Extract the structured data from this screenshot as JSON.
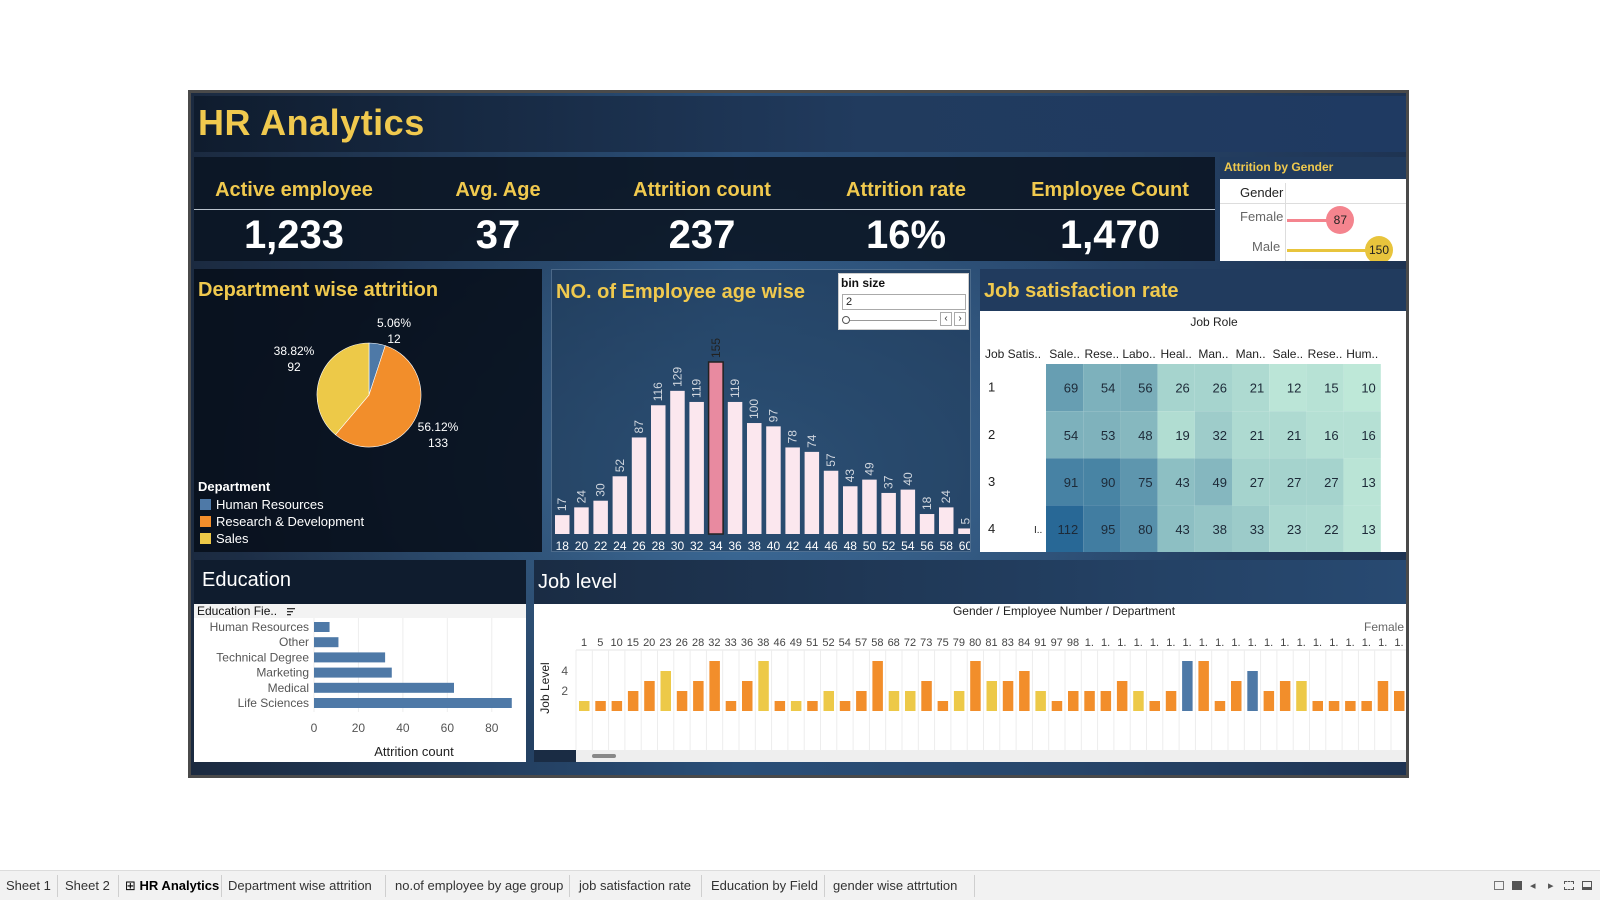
{
  "title": "HR Analytics",
  "kpis": [
    {
      "label": "Active employee",
      "value": "1,233"
    },
    {
      "label": "Avg. Age",
      "value": "37"
    },
    {
      "label": "Attrition count",
      "value": "237"
    },
    {
      "label": "Attrition rate",
      "value": "16%"
    },
    {
      "label": "Employee Count",
      "value": "1,470"
    }
  ],
  "gender_panel": {
    "title": "Attrition by Gender",
    "column": "Gender",
    "rows": [
      {
        "label": "Female",
        "value": 87,
        "color": "#f4848e"
      },
      {
        "label": "Male",
        "value": 150,
        "color": "#e8c43c"
      }
    ]
  },
  "department_panel": {
    "title": "Department wise attrition",
    "legend_title": "Department",
    "slices": [
      {
        "name": "Human Resources",
        "value": 12,
        "pct": "5.06%",
        "color": "#4e79a7"
      },
      {
        "name": "Research & Development",
        "value": 133,
        "pct": "56.12%",
        "color": "#f28e2b"
      },
      {
        "name": "Sales",
        "value": 92,
        "pct": "38.82%",
        "color": "#edc948"
      }
    ]
  },
  "age_panel": {
    "title": "NO. of Employee age wise",
    "bin_label": "bin size",
    "bin_value": "2",
    "highlight_index": 8,
    "bar_color": "#fbe7ee",
    "highlight_color": "#e88aa0"
  },
  "job_panel": {
    "title": "Job satisfaction rate",
    "column_header": "Job Role",
    "row_header": "Job Satis..",
    "truncated_marker": "I..",
    "columns": [
      "Sale..",
      "Rese..",
      "Labo..",
      "Heal..",
      "Man..",
      "Man..",
      "Sale..",
      "Rese..",
      "Hum.."
    ],
    "rows": [
      {
        "label": "1",
        "values": [
          69,
          54,
          56,
          26,
          26,
          21,
          12,
          15,
          10
        ]
      },
      {
        "label": "2",
        "values": [
          54,
          53,
          48,
          19,
          32,
          21,
          21,
          16,
          16
        ]
      },
      {
        "label": "3",
        "values": [
          91,
          90,
          75,
          43,
          49,
          27,
          27,
          27,
          13
        ]
      },
      {
        "label": "4",
        "values": [
          112,
          95,
          80,
          43,
          38,
          33,
          23,
          22,
          13
        ]
      }
    ]
  },
  "education_panel": {
    "title": "Education",
    "field_header": "Education Fie..",
    "sort_icon": "sort-icon",
    "bar_color": "#4e79a7"
  },
  "level_panel": {
    "title": "Job level",
    "header": "Gender / Employee Number / Department",
    "female_label": "Female",
    "y_label": "Job Level",
    "y_ticks": [
      "4",
      "2"
    ],
    "x_labels": [
      "1",
      "5",
      "10",
      "15",
      "20",
      "23",
      "26",
      "28",
      "32",
      "33",
      "36",
      "38",
      "46",
      "49",
      "51",
      "52",
      "54",
      "57",
      "58",
      "68",
      "72",
      "73",
      "75",
      "79",
      "80",
      "81",
      "83",
      "84",
      "91",
      "97",
      "98",
      "1.",
      "1.",
      "1.",
      "1.",
      "1.",
      "1.",
      "1.",
      "1.",
      "1.",
      "1.",
      "1.",
      "1.",
      "1.",
      "1.",
      "1.",
      "1.",
      "1.",
      "1.",
      "1.",
      "1."
    ],
    "colors": {
      "hr": "#4e79a7",
      "rd": "#f28e2b",
      "sales": "#edc948"
    }
  },
  "chart_data": [
    {
      "type": "pie",
      "title": "Department wise attrition",
      "categories": [
        "Human Resources",
        "Research & Development",
        "Sales"
      ],
      "values": [
        12,
        133,
        92
      ],
      "legend": "bottom-left"
    },
    {
      "type": "bar",
      "title": "NO. of Employee age wise",
      "categories": [
        "18",
        "20",
        "22",
        "24",
        "26",
        "28",
        "30",
        "32",
        "34",
        "36",
        "38",
        "40",
        "42",
        "44",
        "46",
        "48",
        "50",
        "52",
        "54",
        "56",
        "58",
        "60"
      ],
      "values": [
        17,
        24,
        30,
        52,
        87,
        116,
        129,
        119,
        155,
        119,
        100,
        97,
        78,
        74,
        57,
        43,
        49,
        37,
        40,
        18,
        24,
        5
      ]
    },
    {
      "type": "bar",
      "title": "Education",
      "orientation": "horizontal",
      "categories": [
        "Human Resources",
        "Other",
        "Technical Degree",
        "Marketing",
        "Medical",
        "Life Sciences"
      ],
      "values": [
        7,
        11,
        32,
        35,
        63,
        89
      ],
      "xlabel": "Attrition count",
      "x_ticks": [
        "0",
        "20",
        "40",
        "60",
        "80"
      ],
      "xlim": [
        0,
        90
      ]
    },
    {
      "type": "bar",
      "title": "Job level",
      "ylabel": "Job Level",
      "ylim": [
        0,
        5
      ],
      "values": [
        1,
        1,
        1,
        2,
        3,
        4,
        2,
        3,
        5,
        1,
        3,
        5,
        1,
        1,
        1,
        2,
        1,
        2,
        5,
        2,
        2,
        3,
        1,
        2,
        5,
        3,
        3,
        4,
        2,
        1,
        2,
        2,
        2,
        3,
        2,
        1,
        2,
        5,
        5,
        1,
        3,
        4,
        2,
        3,
        3,
        1,
        1,
        1,
        1,
        3,
        2
      ],
      "departments": [
        "sales",
        "rd",
        "rd",
        "rd",
        "rd",
        "sales",
        "rd",
        "rd",
        "rd",
        "rd",
        "rd",
        "sales",
        "rd",
        "sales",
        "rd",
        "sales",
        "rd",
        "rd",
        "rd",
        "sales",
        "sales",
        "rd",
        "rd",
        "sales",
        "rd",
        "sales",
        "rd",
        "rd",
        "sales",
        "rd",
        "rd",
        "rd",
        "rd",
        "rd",
        "sales",
        "rd",
        "rd",
        "hr",
        "rd",
        "rd",
        "rd",
        "hr",
        "rd",
        "rd",
        "sales",
        "rd",
        "rd",
        "rd",
        "rd",
        "rd",
        "rd"
      ]
    }
  ],
  "tabs": [
    {
      "label": "Sheet 1",
      "active": false
    },
    {
      "label": "Sheet 2",
      "active": false
    },
    {
      "label": "HR Analytics",
      "active": true,
      "icon": "dashboard-grid-icon",
      "glyph": "⊞"
    },
    {
      "label": "Department wise attrition",
      "active": false
    },
    {
      "label": "no.of employee by age group",
      "active": false
    },
    {
      "label": "job satisfaction rate",
      "active": false
    },
    {
      "label": "Education by Field",
      "active": false
    },
    {
      "label": "gender wise attrtution",
      "active": false
    }
  ]
}
